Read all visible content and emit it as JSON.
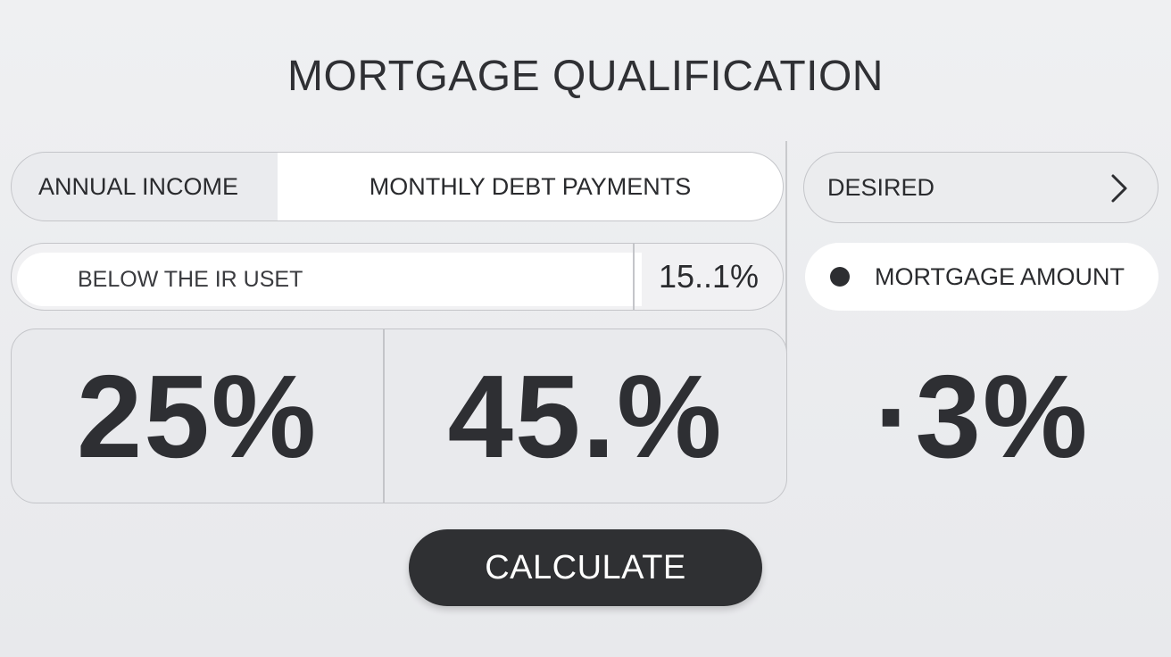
{
  "title": "MORTGAGE QUALIFICATION",
  "income_toggle": {
    "left_label": "ANNUAL INCOME",
    "right_label": "MONTHLY DEBT PAYMENTS"
  },
  "desired_dropdown": {
    "label": "DESIRED",
    "icon": "chevron-right-icon"
  },
  "threshold_input": {
    "value_text": "BELOW THE IR USET",
    "percent": "15..1%"
  },
  "mortgage_option": {
    "label": "MORTGAGE AMOUNT",
    "selected": true
  },
  "stats": {
    "first": "25%",
    "second": "45.%",
    "third": "·3%"
  },
  "calculate_button": {
    "label": "CALCULATE"
  },
  "colors": {
    "background": "#eceef0",
    "accent_dark": "#2f3033",
    "border": "#c4c5c9",
    "white": "#ffffff"
  }
}
